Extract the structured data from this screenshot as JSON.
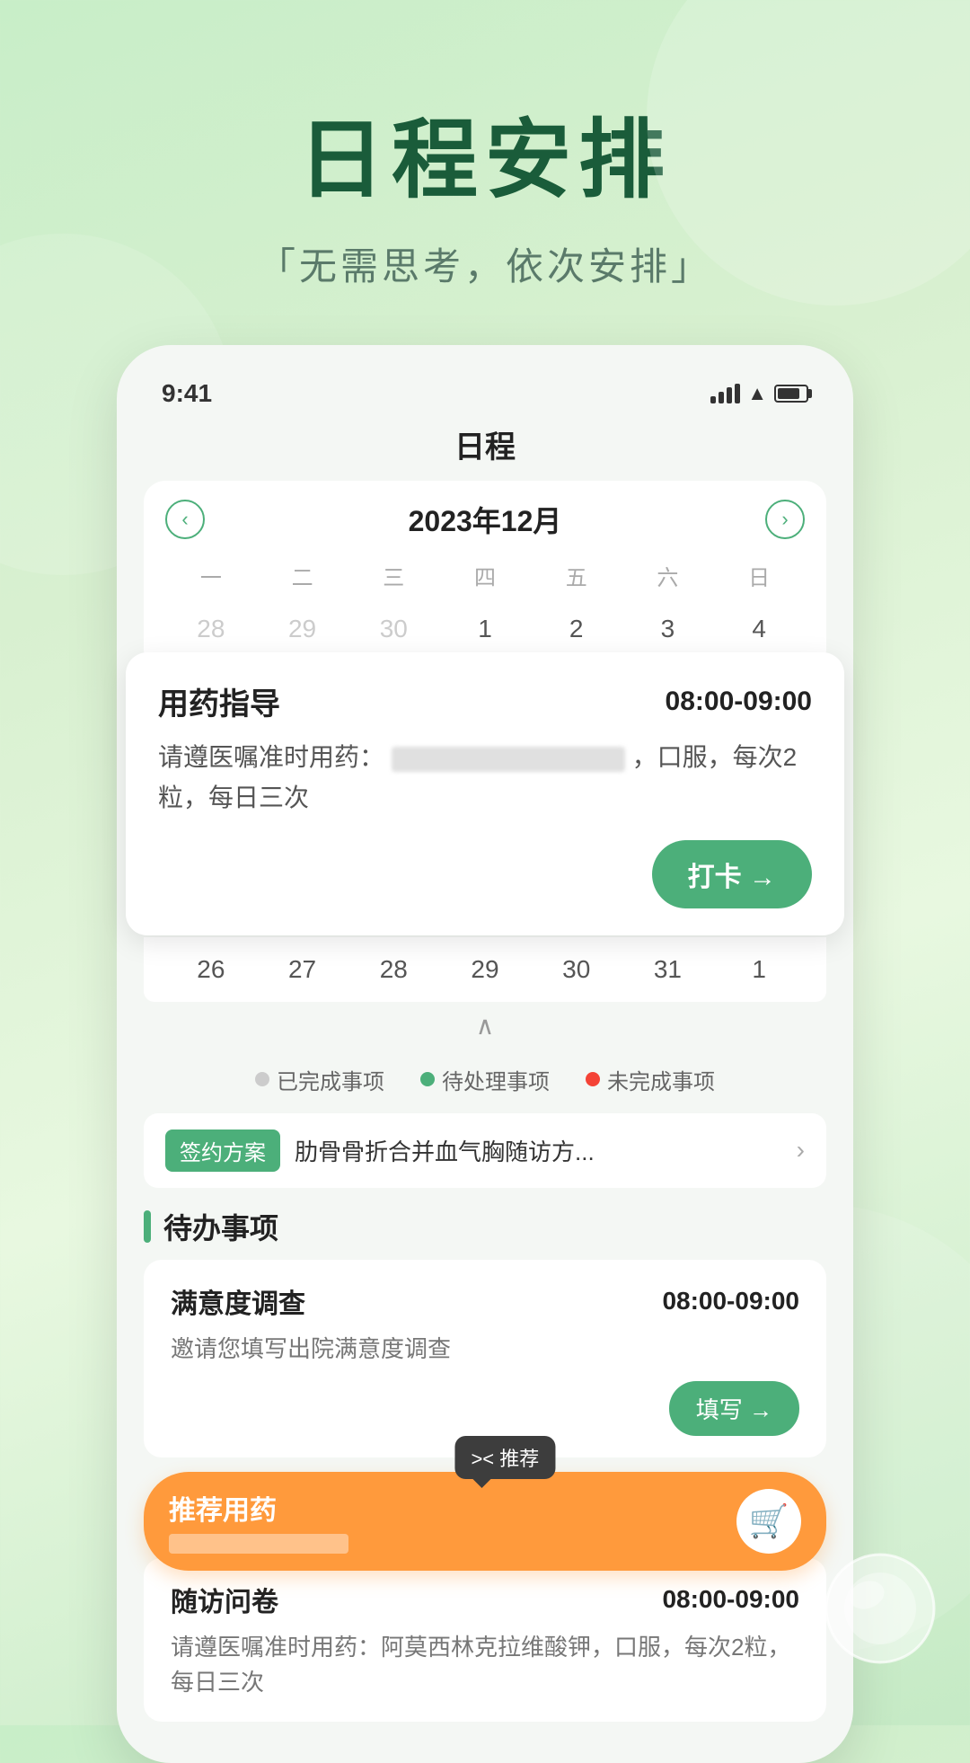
{
  "background": {
    "gradient_start": "#c8eec8",
    "gradient_end": "#c5eac5"
  },
  "header": {
    "main_title": "日程安排",
    "sub_title": "「无需思考，依次安排」"
  },
  "status_bar": {
    "time": "9:41",
    "signal": "signal",
    "wifi": "wifi",
    "battery": "battery"
  },
  "app_title": "日程",
  "calendar": {
    "month_label": "2023年12月",
    "prev_btn": "‹",
    "next_btn": "›",
    "weekdays": [
      "一",
      "二",
      "三",
      "四",
      "五",
      "六",
      "日"
    ],
    "week1": [
      "28",
      "29",
      "30",
      "1",
      "2",
      "3",
      "4"
    ],
    "week1_other": [
      true,
      true,
      true,
      false,
      false,
      false,
      false
    ],
    "week1_today": [
      false,
      false,
      false,
      false,
      false,
      false,
      false
    ],
    "week2": [
      "26",
      "27",
      "28",
      "29",
      "30",
      "31",
      "1"
    ],
    "week2_other": [
      false,
      false,
      false,
      false,
      false,
      false,
      true
    ]
  },
  "med_card": {
    "title": "用药指导",
    "time": "08:00-09:00",
    "desc_prefix": "请遵医嘱准时用药：",
    "desc_suffix": "，口服，每次2粒，每日三次",
    "checkin_btn": "打卡 →"
  },
  "legend": [
    {
      "color": "#cccccc",
      "label": "已完成事项"
    },
    {
      "color": "#4caf7a",
      "label": "待处理事项"
    },
    {
      "color": "#f44336",
      "label": "未完成事项"
    }
  ],
  "contract": {
    "tag": "签约方案",
    "text": "肋骨骨折合并血气胸随访方...",
    "arrow": "›"
  },
  "todo_section": {
    "title": "待办事项"
  },
  "tasks": [
    {
      "title": "满意度调查",
      "time": "08:00-09:00",
      "desc": "邀请您填写出院满意度调查",
      "btn": "填写 →"
    },
    {
      "title": "随访问卷",
      "time": "08:00-09:00",
      "desc": "请遵医嘱准时用药：阿莫西林克拉维酸钾，口服，每次2粒，每日三次",
      "btn": null
    }
  ],
  "recommend": {
    "bubble": ">< 推荐",
    "title": "推荐用药",
    "sub_blurred": true,
    "cart_icon": "🛒"
  }
}
